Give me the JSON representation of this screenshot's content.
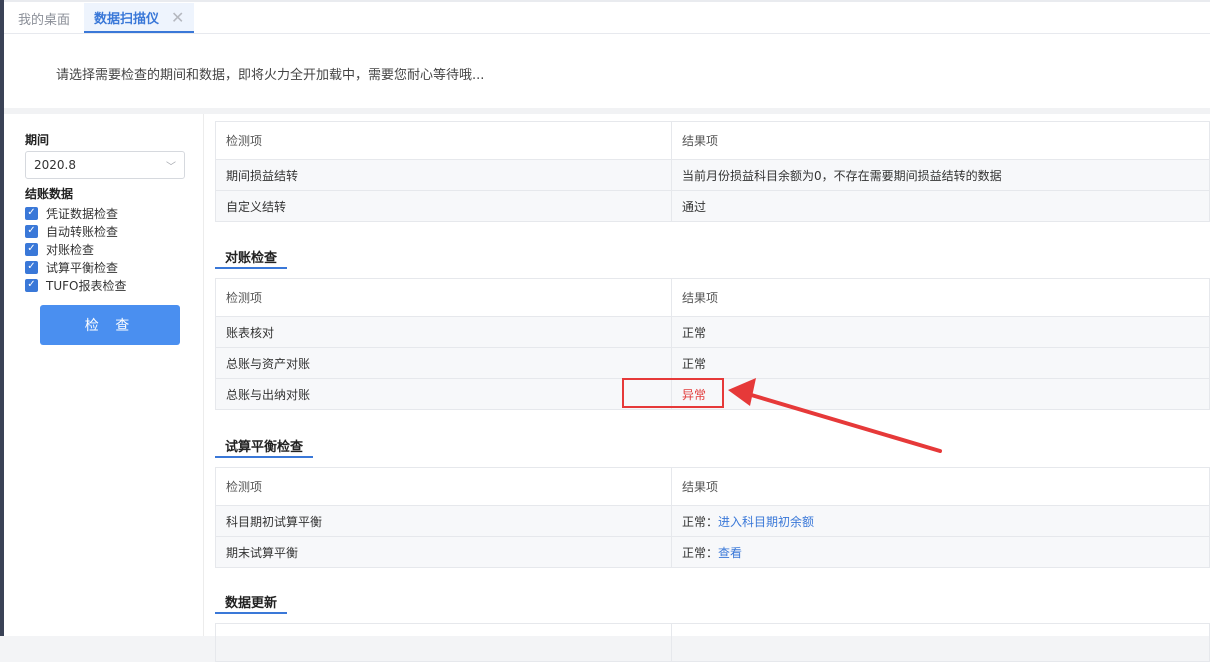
{
  "tabs": [
    {
      "label": "我的桌面",
      "active": false
    },
    {
      "label": "数据扫描仪",
      "active": true,
      "close": "✕"
    }
  ],
  "notice": "请选择需要检查的期间和数据，即将火力全开加载中，需要您耐心等待哦...",
  "sidebar": {
    "period_label": "期间",
    "period_value": "2020.8",
    "data_label": "结账数据",
    "checks": [
      {
        "label": "凭证数据检查",
        "checked": true
      },
      {
        "label": "自动转账检查",
        "checked": true
      },
      {
        "label": "对账检查",
        "checked": true
      },
      {
        "label": "试算平衡检查",
        "checked": true
      },
      {
        "label": "TUFO报表检查",
        "checked": true
      }
    ],
    "check_button": "检 查"
  },
  "sections": {
    "transfer": {
      "head": [
        "检测项",
        "结果项"
      ],
      "rows": [
        {
          "item": "期间损益结转",
          "result": "当前月份损益科目余额为0，不存在需要期间损益结转的数据"
        },
        {
          "item": "自定义结转",
          "result": "通过"
        }
      ]
    },
    "reconcile": {
      "title": "对账检查",
      "head": [
        "检测项",
        "结果项"
      ],
      "rows": [
        {
          "item": "账表核对",
          "result": "正常"
        },
        {
          "item": "总账与资产对账",
          "result": "正常"
        },
        {
          "item": "总账与出纳对账",
          "result": "异常"
        }
      ]
    },
    "balance": {
      "title": "试算平衡检查",
      "head": [
        "检测项",
        "结果项"
      ],
      "rows": [
        {
          "item": "科目期初试算平衡",
          "result": "正常：",
          "link": "进入科目期初余额"
        },
        {
          "item": "期末试算平衡",
          "result": "正常：",
          "link": "查看"
        }
      ]
    },
    "update": {
      "title": "数据更新"
    }
  },
  "colors": {
    "accent": "#3a78d8",
    "error": "#e23c3c",
    "annotation": "#e63939"
  }
}
